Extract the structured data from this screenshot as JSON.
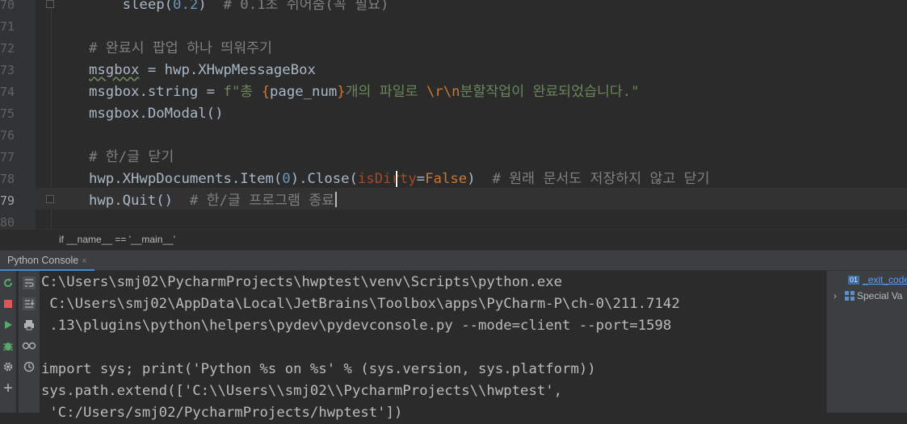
{
  "editor": {
    "line_numbers": [
      "70",
      "71",
      "72",
      "73",
      "74",
      "75",
      "76",
      "77",
      "78",
      "79",
      "80"
    ],
    "lines": {
      "l70": {
        "prefix": "    sleep(",
        "num": "0.2",
        "close": ")  ",
        "comment": "# 0.1초 쉬어줌(꼭 필요)"
      },
      "l72": {
        "comment": "# 완료시 팝업 하나 띄워주기"
      },
      "l73": {
        "var": "msgbox",
        "rest": " = hwp.XHwpMessageBox"
      },
      "l74": {
        "var": "msgbox",
        "rest": ".string = ",
        "str1": "f\"총 ",
        "brace_open": "{",
        "ident": "page_num",
        "brace_close": "}",
        "str2": "개의 파일로 ",
        "esc": "\\r\\n",
        "str3": "분할작업이 완료되었습니다.\""
      },
      "l75": {
        "text": "msgbox.DoModal()"
      },
      "l77": {
        "comment": "# 한/글 닫기"
      },
      "l78": {
        "a": "hwp.XHwpDocuments.Item(",
        "num": "0",
        "b": ").Close(",
        "param": "isDirty",
        "eq": "=",
        "kw": "False",
        "c": ")  ",
        "comment": "# 원래 문서도 저장하지 않고 닫기"
      },
      "l79": {
        "a": "hwp.Quit()  ",
        "comment": "# 한/글 프로그램 종료"
      }
    }
  },
  "breadcrumb": "if __name__ == '__main__'",
  "tab": {
    "label": "Python Console",
    "close": "×"
  },
  "console": {
    "lines": [
      "C:\\Users\\smj02\\PycharmProjects\\hwptest\\venv\\Scripts\\python.exe",
      " C:\\Users\\smj02\\AppData\\Local\\JetBrains\\Toolbox\\apps\\PyCharm-P\\ch-0\\211.7142",
      " .13\\plugins\\python\\helpers\\pydev\\pydevconsole.py --mode=client --port=1598",
      "",
      "import sys; print('Python %s on %s' % (sys.version, sys.platform))",
      "sys.path.extend(['C:\\\\Users\\\\smj02\\\\PycharmProjects\\\\hwptest',",
      " 'C:/Users/smj02/PycharmProjects/hwptest'])"
    ]
  },
  "variables": {
    "items": [
      {
        "badge": "01",
        "label": "_exit_code"
      },
      {
        "label": "Special Va"
      }
    ]
  },
  "colors": {
    "accent": "#4a88c7",
    "comment": "#808080",
    "string": "#6a8759",
    "number": "#6897bb",
    "keyword": "#cc7832",
    "param": "#aa4926"
  }
}
